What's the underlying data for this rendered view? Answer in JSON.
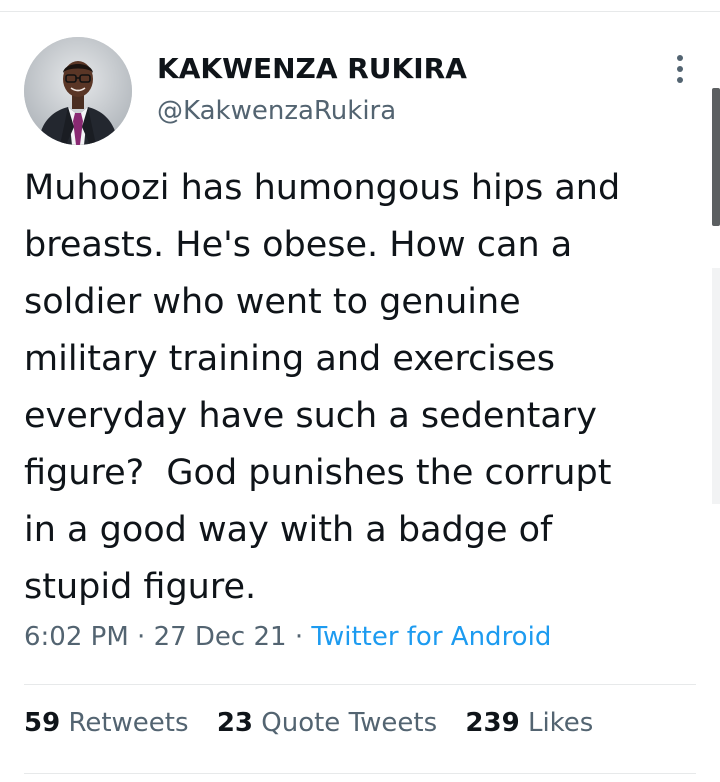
{
  "tweet": {
    "author": {
      "display_name": "KAKWENZA RUKIRA",
      "handle": "@KakwenzaRukira",
      "avatar_icon": "person-in-suit-photo"
    },
    "more_icon": "more-vertical-icon",
    "text_lines": [
      "Muhoozi has humongous hips and",
      "breasts. He's obese. How can a",
      "soldier who went to genuine",
      "military training and exercises",
      "everyday have such a sedentary",
      "figure?  God punishes the corrupt",
      "in a good way with a badge of",
      "stupid figure."
    ],
    "time": "6:02 PM",
    "separator": "·",
    "date": "27 Dec 21",
    "source": "Twitter for Android",
    "stats": {
      "retweets": {
        "count": "59",
        "label": "Retweets"
      },
      "quote_tweets": {
        "count": "23",
        "label": "Quote Tweets"
      },
      "likes": {
        "count": "239",
        "label": "Likes"
      }
    }
  },
  "colors": {
    "text_primary": "#0f1419",
    "text_secondary": "#536471",
    "link": "#1d9bf0",
    "divider": "#e7e9ea"
  }
}
